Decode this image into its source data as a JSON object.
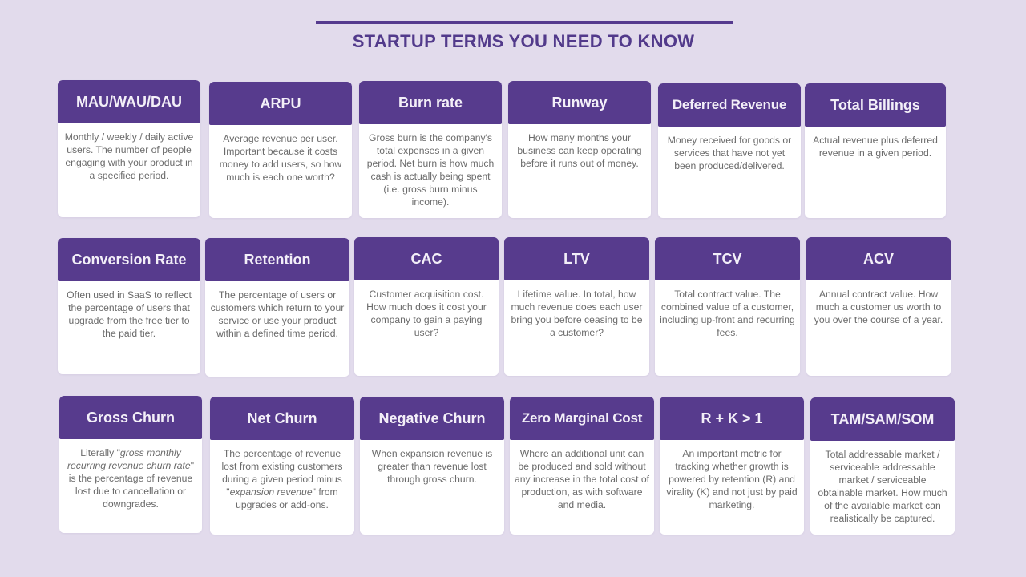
{
  "page": {
    "title": "STARTUP TERMS YOU NEED TO KNOW",
    "colors": {
      "background": "#e2dbec",
      "accent": "#573b8d",
      "title": "#523a8b",
      "card_body": "#ffffff",
      "body_text": "#6b6b6b"
    }
  },
  "rows": [
    {
      "cards": [
        {
          "term": "MAU/WAU/DAU",
          "definition": "Monthly / weekly / daily active users. The number of people engaging with your product in a specified period."
        },
        {
          "term": "ARPU",
          "definition": "Average revenue per user. Important because it costs money to add users, so how much is each one worth?"
        },
        {
          "term": "Burn rate",
          "definition": "Gross burn is the company's total expenses in a given period. Net burn is how much cash is actually being spent (i.e. gross burn minus income)."
        },
        {
          "term": "Runway",
          "definition": "How many months your business can keep operating before it runs out of money."
        },
        {
          "term": "Deferred Revenue",
          "definition": "Money received for goods or services that have not yet been produced/delivered."
        },
        {
          "term": "Total Billings",
          "definition": "Actual revenue plus deferred revenue in a given period."
        }
      ]
    },
    {
      "cards": [
        {
          "term": "Conversion Rate",
          "definition": "Often used in SaaS to reflect the percentage of users that upgrade from the free tier to the paid tier."
        },
        {
          "term": "Retention",
          "definition": "The percentage of users or customers which return to your service or use your product within a defined time period."
        },
        {
          "term": "CAC",
          "definition": "Customer acquisition cost. How much does it cost your company to gain a paying user?"
        },
        {
          "term": "LTV",
          "definition": "Lifetime value. In total, how much revenue does each user bring you before ceasing to be a customer?"
        },
        {
          "term": "TCV",
          "definition": "Total contract value. The combined value of a customer, including up-front and recurring fees."
        },
        {
          "term": "ACV",
          "definition": "Annual contract value. How much a customer us worth to you over the course of a year."
        }
      ]
    },
    {
      "cards": [
        {
          "term": "Gross Churn",
          "definition_parts": {
            "before": "Literally \"",
            "italic": "gross monthly recurring revenue churn rate",
            "after": "\" is the percentage of revenue lost due to cancellation or downgrades."
          }
        },
        {
          "term": "Net Churn",
          "definition_parts": {
            "before": "The percentage of revenue lost from existing customers during a given period minus \"",
            "italic": "expansion revenue",
            "after": "\" from upgrades or add-ons."
          }
        },
        {
          "term": "Negative Churn",
          "definition": "When expansion revenue is greater than revenue lost through gross churn."
        },
        {
          "term": "Zero Marginal Cost",
          "definition": "Where an additional unit can be produced and sold without any increase in the total cost of production, as with software and media."
        },
        {
          "term": "R + K > 1",
          "definition": "An important metric for tracking whether growth is powered by retention (R) and virality (K) and not just by paid marketing."
        },
        {
          "term": "TAM/SAM/SOM",
          "definition": "Total addressable market / serviceable addressable market / serviceable obtainable market. How much of the available market can realistically be captured."
        }
      ]
    }
  ]
}
